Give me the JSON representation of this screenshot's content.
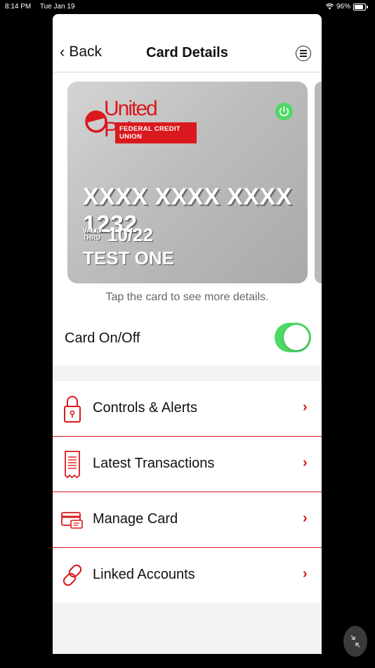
{
  "status": {
    "time": "8:14 PM",
    "date": "Tue Jan 19",
    "battery": "96%"
  },
  "nav": {
    "back_label": "Back",
    "title": "Card Details"
  },
  "card": {
    "brand_name": "United Poles",
    "brand_sub": "FEDERAL CREDIT UNION",
    "number": "XXXX XXXX XXXX 1232",
    "valid_label_1": "VALID",
    "valid_label_2": "THRU",
    "expiry": "10/22",
    "holder": "TEST ONE"
  },
  "hint": "Tap the card to see more details.",
  "toggle": {
    "label": "Card On/Off",
    "state": "on"
  },
  "menu": [
    {
      "label": "Controls & Alerts",
      "icon": "lock-icon"
    },
    {
      "label": "Latest Transactions",
      "icon": "receipt-icon"
    },
    {
      "label": "Manage Card",
      "icon": "card-icon"
    },
    {
      "label": "Linked Accounts",
      "icon": "link-icon"
    }
  ],
  "colors": {
    "accent": "#d9191d",
    "toggle_on": "#4cd964"
  }
}
